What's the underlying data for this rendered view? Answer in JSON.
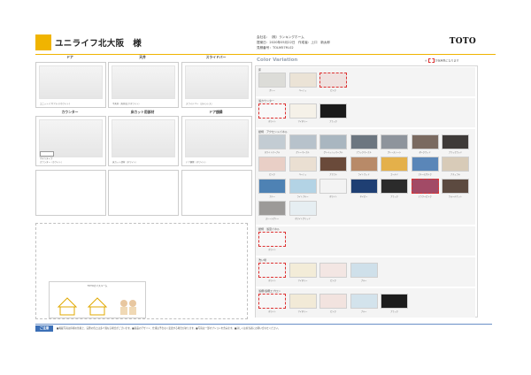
{
  "header": {
    "title": "ユニライフ北大阪　様",
    "info_line1": "会社名：（株）ランキングホーム",
    "info_line2": "提案日：2020年05月22日　作成者：上口　新太郎",
    "info_line3": "見積番号：TOLM57M-02",
    "logo": "TOTO"
  },
  "panels": [
    {
      "label": "ドア",
      "caption": "ユニットドア(アルミ/ホワイト)"
    },
    {
      "label": "天井",
      "caption": "平天井（天井高さ/ホワイト）"
    },
    {
      "label": "スライドバー",
      "caption": "スライドバー（ステンレス）"
    },
    {
      "label": "カウンター",
      "caption": "カウンター（ホワイト）",
      "option": "手すりタイプ"
    },
    {
      "label": "床カット用部材",
      "caption": "床カット部材（ホワイト）"
    },
    {
      "label": "ドア額縁",
      "caption": "ドア額縁（ホワイト）"
    }
  ],
  "logo_area": {
    "title": "TOTOのバスルーム"
  },
  "color_variation": {
    "title": "Color Variation",
    "note_before": "※",
    "note_after": "が採用色になります",
    "sections": [
      {
        "label": "床",
        "swatches": [
          {
            "name": "グレー",
            "color": "#dcdcd8",
            "selected": false
          },
          {
            "name": "ベージュ",
            "color": "#ebe3d6",
            "selected": false
          },
          {
            "name": "ピンク",
            "color": "#efe1df",
            "selected": true
          }
        ]
      },
      {
        "label": "浴カウンター",
        "swatches": [
          {
            "name": "ホワイト",
            "color": "#f9f9f9",
            "selected": true
          },
          {
            "name": "アイボリー",
            "color": "#f5f1e8",
            "selected": false
          },
          {
            "name": "ブラック",
            "color": "#1a1a1a",
            "selected": false
          }
        ]
      },
      {
        "label": "壁柄　アクセントパネル",
        "swatches": [
          {
            "name": "ホワイトマーブル",
            "color": "#c3ccd3",
            "selected": false
          },
          {
            "name": "グレーマーブル",
            "color": "#b7c2cb",
            "selected": false
          },
          {
            "name": "グレイッシュマーブル",
            "color": "#a9b6c0",
            "selected": false
          },
          {
            "name": "ブラックマーブル",
            "color": "#6c7680",
            "selected": false
          },
          {
            "name": "グレーストーン",
            "color": "#8e949c",
            "selected": false
          },
          {
            "name": "ダークウッド",
            "color": "#7a6a60",
            "selected": false
          },
          {
            "name": "ブラックウッド",
            "color": "#3e3a38",
            "selected": false
          },
          {
            "name": "ピンク",
            "color": "#e9cfc6",
            "selected": false
          },
          {
            "name": "ベージュ",
            "color": "#eadfd2",
            "selected": false
          },
          {
            "name": "ブラウン",
            "color": "#6a4a3a",
            "selected": false
          },
          {
            "name": "ライトウッド",
            "color": "#b88a68",
            "selected": false
          },
          {
            "name": "ゴールド",
            "color": "#e4b04a",
            "selected": false
          },
          {
            "name": "ブルーモザイク",
            "color": "#5a86b8",
            "selected": false
          },
          {
            "name": "ナチュラル",
            "color": "#d8cbb8",
            "selected": false
          },
          {
            "name": "ブルー",
            "color": "#4e82b4",
            "selected": false
          },
          {
            "name": "ライトブルー",
            "color": "#b3d3e5",
            "selected": false
          },
          {
            "name": "ホワイト",
            "color": "#f3f3f3",
            "selected": false
          },
          {
            "name": "ネイビー",
            "color": "#1f3f73",
            "selected": false
          },
          {
            "name": "ブラック",
            "color": "#2b2b2b",
            "selected": false
          },
          {
            "name": "フラワーピンク",
            "color": "#a24a66",
            "selected": true
          },
          {
            "name": "ウォールナット",
            "color": "#5c4a40",
            "selected": false
          },
          {
            "name": "ストーングレー",
            "color": "#9c9a98",
            "selected": false
          },
          {
            "name": "ホワイトグリッド",
            "color": "#e6eef2",
            "selected": false
          }
        ]
      },
      {
        "label": "壁柄　浴室パネル",
        "swatches": [
          {
            "name": "ホワイト",
            "color": "#f8f8f8",
            "selected": true
          }
        ]
      },
      {
        "label": "洗い場",
        "swatches": [
          {
            "name": "ホワイト",
            "color": "#f6f6f6",
            "selected": true
          },
          {
            "name": "アイボリー",
            "color": "#f3ecd8",
            "selected": false
          },
          {
            "name": "ピンク",
            "color": "#f3e6e3",
            "selected": false
          },
          {
            "name": "ブルー",
            "color": "#cfe0ea",
            "selected": false
          }
        ]
      },
      {
        "label": "浴槽/浴槽エプロン",
        "swatches": [
          {
            "name": "ホワイト",
            "color": "#f7f7f7",
            "selected": true
          },
          {
            "name": "アイボリー",
            "color": "#f2ead7",
            "selected": false
          },
          {
            "name": "ピンク",
            "color": "#f2e3df",
            "selected": false
          },
          {
            "name": "ブルー",
            "color": "#d3e3ec",
            "selected": false
          },
          {
            "name": "ブラック",
            "color": "#1c1c1c",
            "selected": false
          }
        ]
      }
    ]
  },
  "footer": {
    "badge": "ご注意",
    "text": "■掲載写真は印刷の性質上、実際の色とは多少異なる場合がございます。■商品のデザイン、仕様は予告なく変更する場合があります。■写真は一部オプションを含みます。■詳しくは担当者にお問い合わせください。"
  }
}
